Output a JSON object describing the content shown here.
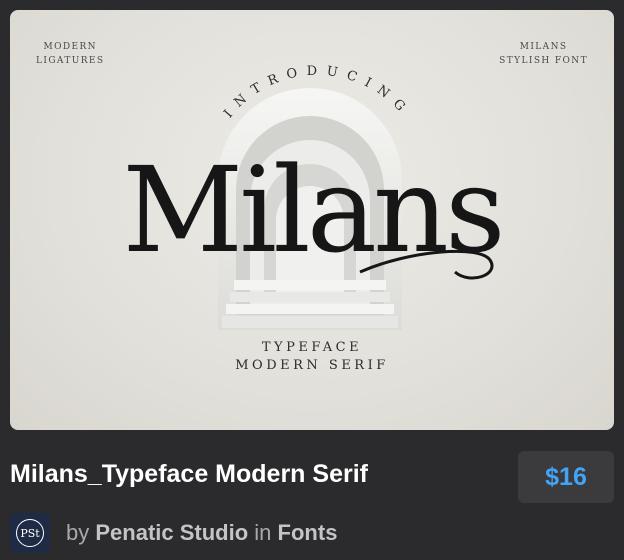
{
  "preview": {
    "corner_left": [
      "MODERN",
      "LIGATURES"
    ],
    "corner_right": [
      "MILANS",
      "STYLISH FONT"
    ],
    "intro_text": "INTRODUCING",
    "wordmark": "Milans",
    "line1": "TYPEFACE",
    "line2": "MODERN SERIF"
  },
  "product": {
    "title": "Milans_Typeface Modern Serif",
    "price": "$16",
    "by": "by",
    "author": "Penatic Studio",
    "in": "in",
    "category": "Fonts",
    "avatar_text": "PSt"
  },
  "colors": {
    "page_bg": "#2b2b2d",
    "price": "#43a3f5",
    "price_box": "#3b3b3e",
    "preview_bg": "#e4e2dc"
  }
}
